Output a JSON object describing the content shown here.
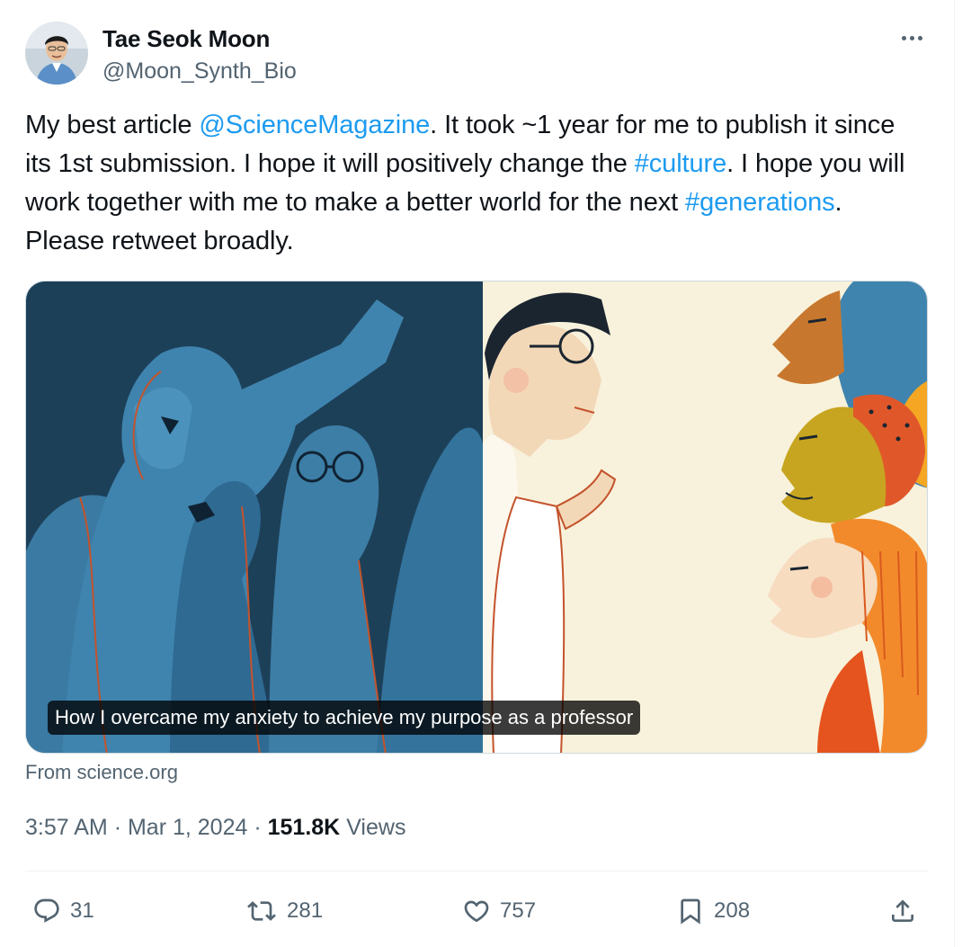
{
  "author": {
    "name": "Tae Seok Moon",
    "handle": "@Moon_Synth_Bio"
  },
  "post": {
    "segments": [
      {
        "text": "My best article ",
        "type": "text"
      },
      {
        "text": "@ScienceMagazine",
        "type": "mention"
      },
      {
        "text": ". It took ~1 year for me to publish it since its 1st submission. I hope it will positively change the ",
        "type": "text"
      },
      {
        "text": "#culture",
        "type": "hashtag"
      },
      {
        "text": ". I hope you will work together with me to make a better world for the next ",
        "type": "text"
      },
      {
        "text": "#generations",
        "type": "hashtag"
      },
      {
        "text": ". Please retweet broadly.",
        "type": "text"
      }
    ]
  },
  "card": {
    "title": "How I overcame my anxiety to achieve my purpose as a professor",
    "source": "From science.org"
  },
  "meta": {
    "time": "3:57 AM",
    "separator": "·",
    "date": "Mar 1, 2024",
    "views_count": "151.8K",
    "views_label": "Views"
  },
  "actions": {
    "replies": "31",
    "reposts": "281",
    "likes": "757",
    "bookmarks": "208"
  },
  "icons": {
    "more": "more-horizontal-icon",
    "reply": "reply-icon",
    "repost": "repost-icon",
    "like": "heart-icon",
    "bookmark": "bookmark-icon",
    "share": "share-icon"
  },
  "colors": {
    "link": "#1d9bf0",
    "text_primary": "#0f1419",
    "text_secondary": "#536471",
    "border": "#cfd9de",
    "illustration_blue": "#3d7ea6",
    "illustration_cream": "#f8f2dc",
    "illustration_orange": "#e8642c"
  }
}
